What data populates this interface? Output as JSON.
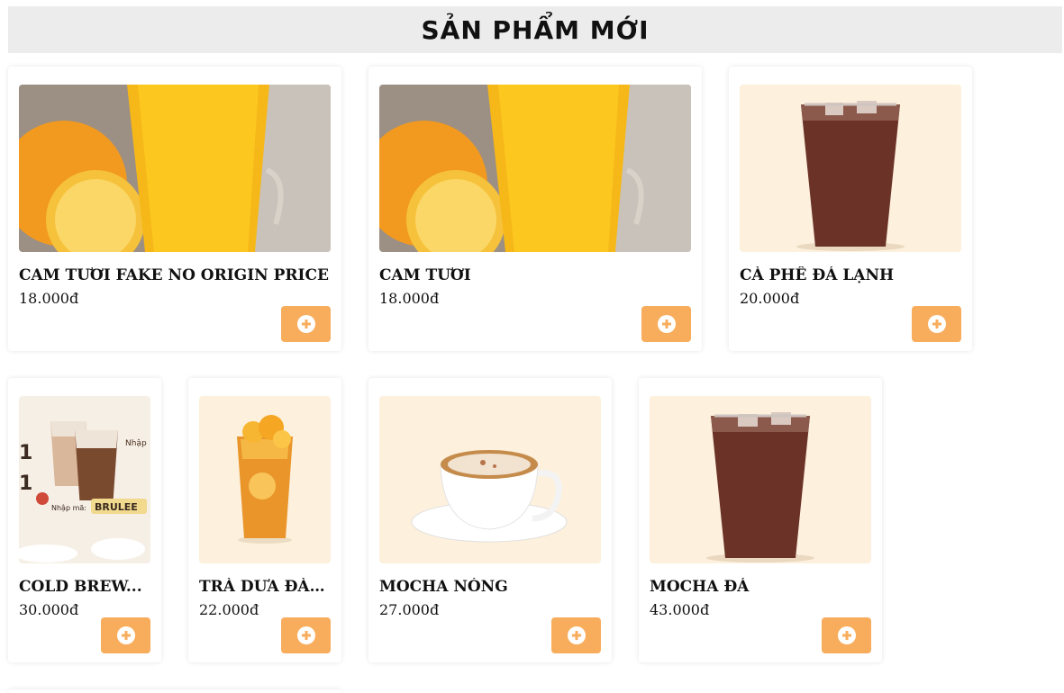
{
  "section": {
    "title": "SẢN PHẨM MỚI"
  },
  "products": [
    {
      "name": "CAM TƯƠI FAKE NO ORIGIN PRICE",
      "price": "18.000đ",
      "image": "orange-juice"
    },
    {
      "name": "CAM TƯƠI",
      "price": "18.000đ",
      "image": "orange-juice"
    },
    {
      "name": "CÀ PHÊ ĐÁ LẠNH",
      "price": "20.000đ",
      "image": "iced-coffee"
    },
    {
      "name": "COLD BREW...",
      "price": "30.000đ",
      "image": "cold-brew-promo",
      "promo_text": "Nhập mã: BRULEE"
    },
    {
      "name": "TRÀ DƯA ĐÀO...",
      "price": "22.000đ",
      "image": "peach-tea"
    },
    {
      "name": "MOCHA NÓNG",
      "price": "27.000đ",
      "image": "hot-mocha"
    },
    {
      "name": "MOCHA ĐÁ",
      "price": "43.000đ",
      "image": "iced-coffee"
    }
  ],
  "icons": {
    "add": "plus-circle-icon"
  },
  "colors": {
    "accent": "#f8ad5d",
    "header_bg": "#ececec",
    "image_bg": "#fdf0dc"
  }
}
